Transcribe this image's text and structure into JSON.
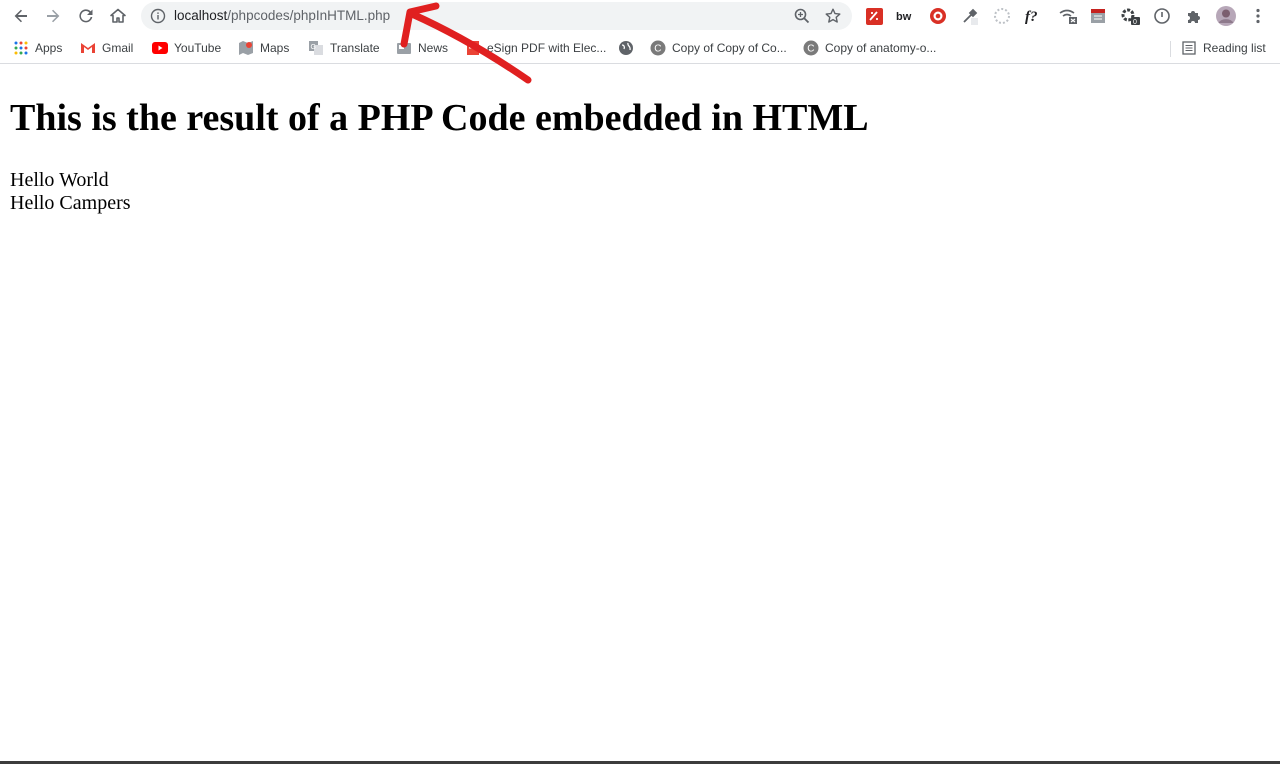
{
  "browser": {
    "url_host": "localhost",
    "url_path": "/phpcodes/phpInHTML.php",
    "bookmarks": [
      {
        "label": "Apps",
        "icon": "apps-grid-icon"
      },
      {
        "label": "Gmail",
        "icon": "gmail-icon"
      },
      {
        "label": "YouTube",
        "icon": "youtube-icon"
      },
      {
        "label": "Maps",
        "icon": "maps-icon"
      },
      {
        "label": "Translate",
        "icon": "translate-icon"
      },
      {
        "label": "News",
        "icon": "news-icon"
      },
      {
        "label": "eSign PDF with Elec...",
        "icon": "esign-icon"
      },
      {
        "label": "",
        "icon": "globe-icon"
      },
      {
        "label": "Copy of Copy of Co...",
        "icon": "canva-icon"
      },
      {
        "label": "Copy of anatomy-o...",
        "icon": "canva-icon"
      }
    ],
    "reading_list": "Reading list",
    "colors": {
      "accent_red": "#d93025",
      "annotation_arrow": "#e02020"
    }
  },
  "page": {
    "heading": "This is the result of a PHP Code embedded in HTML",
    "lines": [
      "Hello World",
      "Hello Campers"
    ]
  }
}
